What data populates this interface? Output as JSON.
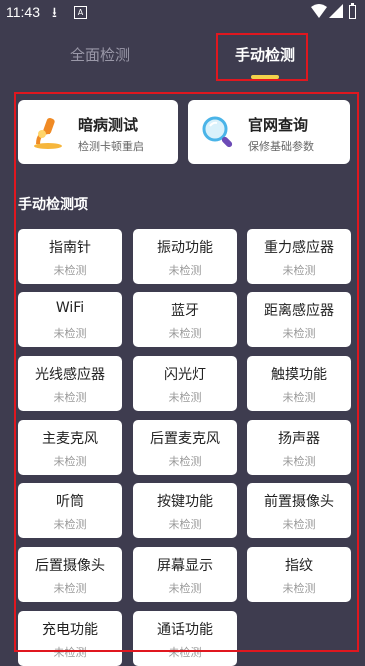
{
  "status_bar": {
    "time": "11:43",
    "account_badge": "A",
    "download_icon": "download-icon",
    "wifi_icon": "wifi-icon",
    "signal_icon": "signal-icon",
    "battery_icon": "battery-icon"
  },
  "tabs": {
    "full_label": "全面检测",
    "manual_label": "手动检测",
    "active": "手动检测"
  },
  "highlight_color": "#e0171f",
  "accent_color": "#f3d34a",
  "cards": [
    {
      "title": "暗病测试",
      "subtitle": "检测卡顿重启",
      "icon": "microscope-icon"
    },
    {
      "title": "官网查询",
      "subtitle": "保修基础参数",
      "icon": "search-icon"
    }
  ],
  "section_title": "手动检测项",
  "items": [
    {
      "name": "指南针",
      "status": "未检测"
    },
    {
      "name": "振动功能",
      "status": "未检测"
    },
    {
      "name": "重力感应器",
      "status": "未检测"
    },
    {
      "name": "WiFi",
      "status": "未检测"
    },
    {
      "name": "蓝牙",
      "status": "未检测"
    },
    {
      "name": "距离感应器",
      "status": "未检测"
    },
    {
      "name": "光线感应器",
      "status": "未检测"
    },
    {
      "name": "闪光灯",
      "status": "未检测"
    },
    {
      "name": "触摸功能",
      "status": "未检测"
    },
    {
      "name": "主麦克风",
      "status": "未检测"
    },
    {
      "name": "后置麦克风",
      "status": "未检测"
    },
    {
      "name": "扬声器",
      "status": "未检测"
    },
    {
      "name": "听筒",
      "status": "未检测"
    },
    {
      "name": "按键功能",
      "status": "未检测"
    },
    {
      "name": "前置摄像头",
      "status": "未检测"
    },
    {
      "name": "后置摄像头",
      "status": "未检测"
    },
    {
      "name": "屏幕显示",
      "status": "未检测"
    },
    {
      "name": "指纹",
      "status": "未检测"
    },
    {
      "name": "充电功能",
      "status": "未检测"
    },
    {
      "name": "通话功能",
      "status": "未检测"
    }
  ]
}
